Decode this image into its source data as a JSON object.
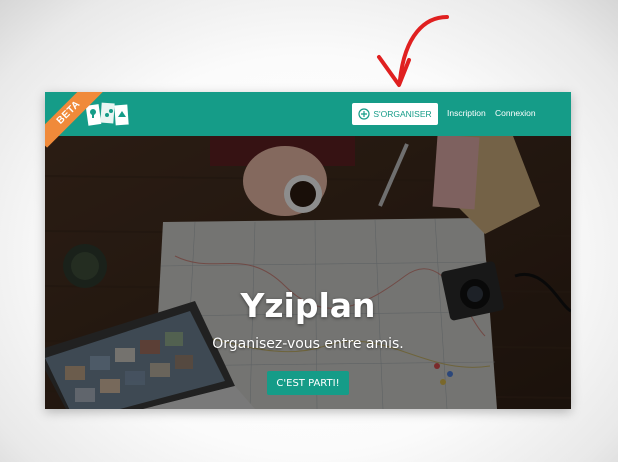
{
  "header": {
    "badge": "BETA",
    "organize_label": "S'ORGANISER",
    "signup_label": "Inscription",
    "login_label": "Connexion"
  },
  "hero": {
    "title": "Yziplan",
    "subtitle": "Organisez-vous entre amis.",
    "cta_label": "C'EST PARTI!"
  },
  "icons": [
    "logo-icon",
    "plus-circle-icon",
    "arrow-annotation"
  ],
  "colors": {
    "brand": "#159c88",
    "beta_badge": "#f08a3a",
    "annotation": "#e02020"
  }
}
